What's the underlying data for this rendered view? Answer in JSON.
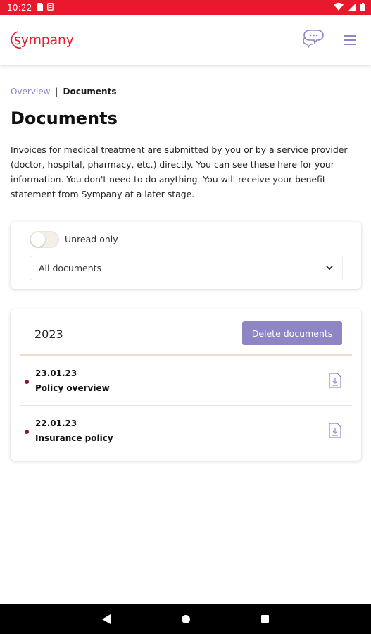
{
  "status_bar": {
    "time": "10:22",
    "icons_left": [
      "sim-card-icon",
      "storage-icon"
    ],
    "icons_right": [
      "wifi-icon",
      "signal-icon",
      "battery-icon"
    ],
    "background": "#e8192c"
  },
  "header": {
    "logo_text": "sympany",
    "brand_color": "#e8192c",
    "chat_icon": "chat-bubbles-icon",
    "menu_icon": "hamburger-menu-icon"
  },
  "breadcrumb": {
    "items": [
      {
        "label": "Overview"
      },
      {
        "label": "Documents"
      }
    ],
    "separator": "|"
  },
  "page": {
    "title": "Documents",
    "intro": "Invoices for medical treatment are submitted by you or by a service provider (doctor, hospital, pharmacy, etc.) directly. You can see these here for your information. You don't need to do anything. You will receive your benefit statement from Sympany at a later stage."
  },
  "filters": {
    "unread_only_label": "Unread only",
    "unread_only_enabled": false,
    "document_type_value": "All documents"
  },
  "documents": {
    "year": "2023",
    "delete_button_label": "Delete documents",
    "accent_color": "#8e86c4",
    "items": [
      {
        "date": "23.01.23",
        "title": "Policy overview",
        "unread": true
      },
      {
        "date": "22.01.23",
        "title": "Insurance policy",
        "unread": true
      }
    ]
  },
  "nav_bar": {
    "buttons": [
      "back-icon",
      "home-icon",
      "recent-apps-icon"
    ]
  }
}
